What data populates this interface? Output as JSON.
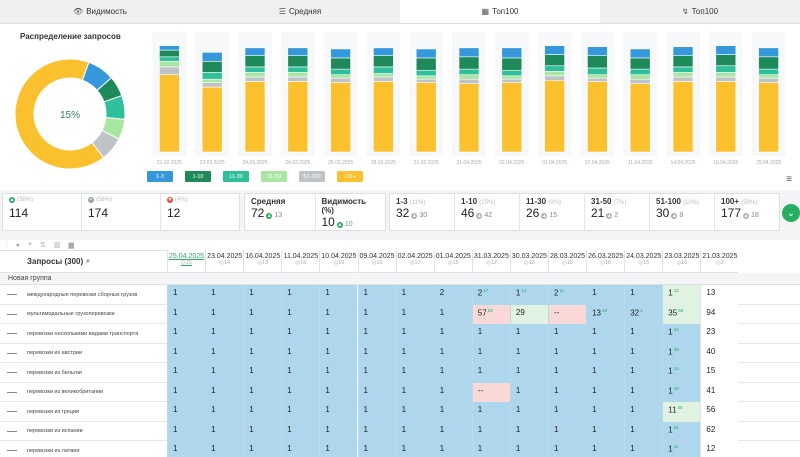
{
  "tabs": [
    {
      "label": "Видимость",
      "icon": "eye-icon",
      "glyph": "👁"
    },
    {
      "label": "Средняя",
      "icon": "list-icon",
      "glyph": "☰"
    },
    {
      "label": "Топ100",
      "icon": "calendar-icon",
      "glyph": "▦"
    },
    {
      "label": "Топ100",
      "icon": "trend-icon",
      "glyph": "↯"
    }
  ],
  "distribution": {
    "title": "Распределение запросов",
    "center_label": "15%",
    "slices": [
      {
        "range": "1-3",
        "value": 8,
        "color": "#3498db"
      },
      {
        "range": "1-10",
        "value": 6,
        "color": "#1e8a5a"
      },
      {
        "range": "11-30",
        "value": 7,
        "color": "#2fbf9b"
      },
      {
        "range": "31-50",
        "value": 6,
        "color": "#a8e6a1"
      },
      {
        "range": "51-100",
        "value": 7,
        "color": "#bdc3c7"
      },
      {
        "range": "101+",
        "value": 66,
        "color": "#fbc02d"
      }
    ]
  },
  "chart_data": {
    "type": "bar",
    "stacked": true,
    "categories": [
      "21.02.2025",
      "",
      "",
      "",
      "",
      "",
      "",
      "",
      "",
      "",
      "",
      "",
      "",
      "",
      "",
      "",
      ""
    ],
    "tick_labels": [
      "21.02.2025",
      "",
      "23.02.2025",
      "",
      "28.03.2025",
      "",
      "28.03.2025",
      "",
      "31.03.2025",
      "",
      "31.03.2025",
      "",
      "31.04.2025",
      "",
      "03.04.2025",
      "",
      "15.04.2025"
    ],
    "categories_count": 15,
    "series": [
      {
        "name": "101+",
        "color": "#fbc02d",
        "values": [
          69,
          58,
          63,
          63,
          62,
          63,
          62,
          61,
          62,
          64,
          63,
          61,
          63,
          63,
          62
        ]
      },
      {
        "name": "51-100",
        "color": "#bdc3c7",
        "values": [
          7,
          4,
          4,
          4,
          4,
          4,
          3,
          4,
          3,
          4,
          3,
          4,
          4,
          4,
          4
        ]
      },
      {
        "name": "31-50",
        "color": "#a8e6a1",
        "values": [
          5,
          3,
          4,
          4,
          3,
          3,
          3,
          4,
          3,
          4,
          3,
          4,
          4,
          4,
          3
        ]
      },
      {
        "name": "11-30",
        "color": "#2fbf9b",
        "values": [
          4,
          6,
          5,
          5,
          5,
          6,
          5,
          5,
          5,
          5,
          6,
          5,
          5,
          6,
          5
        ]
      },
      {
        "name": "1-10",
        "color": "#1e8a5a",
        "values": [
          6,
          10,
          10,
          10,
          10,
          10,
          11,
          11,
          11,
          10,
          11,
          10,
          10,
          10,
          11
        ]
      },
      {
        "name": "1-3",
        "color": "#3498db",
        "values": [
          4,
          8,
          7,
          7,
          8,
          7,
          8,
          8,
          9,
          8,
          8,
          8,
          8,
          8,
          8
        ]
      }
    ],
    "x_labels": [
      "21.02.2025",
      "23.03.2025",
      "24.03.2025",
      "24.03.2025",
      "26.03.2025",
      "28.03.2025",
      "31.03.2025",
      "31.04.2025",
      "02.04.2025",
      "03.04.2025",
      "07.04.2025",
      "11.04.2025",
      "14.04.2025",
      "16.04.2025",
      "25.04.2025"
    ],
    "ylim": [
      0,
      100
    ]
  },
  "legend": [
    {
      "label": "1-3",
      "color": "#3498db"
    },
    {
      "label": "1-10",
      "color": "#1e8a5a"
    },
    {
      "label": "11-30",
      "color": "#2fbf9b"
    },
    {
      "label": "31-50",
      "color": "#a8e6a1"
    },
    {
      "label": "51-100",
      "color": "#bdc3c7"
    },
    {
      "label": "101+",
      "color": "#fbc02d"
    }
  ],
  "stats_a": [
    {
      "top": "(38%)",
      "icon": "up",
      "value": "114"
    },
    {
      "top": "(58%)",
      "icon": "same",
      "value": "174"
    },
    {
      "top": "(4%)",
      "icon": "down",
      "value": "12"
    }
  ],
  "stats_b": [
    {
      "label": "Средняя",
      "value": "72",
      "change": "13"
    },
    {
      "label": "Видимость (%)",
      "value": "10",
      "change": "10"
    }
  ],
  "stats_c": [
    {
      "label": "1-3",
      "pct": "(11%)",
      "value": "32",
      "change": "30"
    },
    {
      "label": "1-10",
      "pct": "(15%)",
      "value": "46",
      "change": "42"
    },
    {
      "label": "11-30",
      "pct": "(9%)",
      "value": "26",
      "change": "15"
    },
    {
      "label": "31-50",
      "pct": "(7%)",
      "value": "21",
      "change": "2"
    },
    {
      "label": "51-100",
      "pct": "(10%)",
      "value": "30",
      "change": "8"
    },
    {
      "label": "100+",
      "pct": "(59%)",
      "value": "177",
      "change": "18"
    }
  ],
  "table": {
    "query_header": "Запросы (300)",
    "group": "Новая группа",
    "dates": [
      {
        "date": "25.04.2025",
        "sub": "15"
      },
      {
        "date": "23.04.2025",
        "sub": "14"
      },
      {
        "date": "16.04.2025",
        "sub": "13"
      },
      {
        "date": "11.04.2025",
        "sub": "16"
      },
      {
        "date": "10.04.2025",
        "sub": "16"
      },
      {
        "date": "09.04.2025",
        "sub": "16"
      },
      {
        "date": "02.04.2025",
        "sub": "17"
      },
      {
        "date": "01.04.2025",
        "sub": "15"
      },
      {
        "date": "31.03.2025",
        "sub": "12"
      },
      {
        "date": "30.03.2025",
        "sub": "13"
      },
      {
        "date": "28.03.2025",
        "sub": "15"
      },
      {
        "date": "26.03.2025",
        "sub": "16"
      },
      {
        "date": "24.03.2025",
        "sub": "15"
      },
      {
        "date": "23.03.2025",
        "sub": "16"
      },
      {
        "date": "21.03.2025",
        "sub": "2"
      }
    ],
    "rows": [
      {
        "name": "международные перевозки сборных грузов",
        "cells": [
          "1",
          "1",
          "1",
          "1",
          "1",
          "1",
          "1",
          "2",
          "2",
          "1",
          "2",
          "1",
          "1",
          "1",
          "13"
        ],
        "sups": [
          "",
          "",
          "",
          "",
          "",
          "",
          "",
          "",
          "17",
          "12",
          "11",
          "",
          "",
          "12",
          ""
        ],
        "colors": [
          "b",
          "b",
          "b",
          "b",
          "b",
          "b",
          "b",
          "b",
          "b",
          "b",
          "b",
          "b",
          "b",
          "g",
          "w"
        ]
      },
      {
        "name": "мультимодальные грузоперевозки",
        "cells": [
          "1",
          "1",
          "1",
          "1",
          "1",
          "1",
          "1",
          "1",
          "57",
          "29",
          "--",
          "13",
          "32",
          "35",
          "94"
        ],
        "sups": [
          "",
          "",
          "",
          "",
          "",
          "",
          "",
          "",
          "28",
          "",
          "",
          "19",
          "1",
          "59",
          ""
        ],
        "colors": [
          "b",
          "b",
          "b",
          "b",
          "b",
          "b",
          "b",
          "b",
          "p",
          "g",
          "p",
          "b",
          "b",
          "g",
          "w"
        ]
      },
      {
        "name": "перевозки несколькими видами транспорта",
        "cells": [
          "1",
          "1",
          "1",
          "1",
          "1",
          "1",
          "1",
          "1",
          "1",
          "1",
          "1",
          "1",
          "1",
          "1",
          "23"
        ],
        "sups": [
          "",
          "",
          "",
          "",
          "",
          "",
          "",
          "",
          "",
          "",
          "",
          "",
          "",
          "22",
          ""
        ],
        "colors": [
          "b",
          "b",
          "b",
          "b",
          "b",
          "b",
          "b",
          "b",
          "b",
          "b",
          "b",
          "b",
          "b",
          "b",
          "w"
        ]
      },
      {
        "name": "перевозки из австрии",
        "cells": [
          "1",
          "1",
          "1",
          "1",
          "1",
          "1",
          "1",
          "1",
          "1",
          "1",
          "1",
          "1",
          "1",
          "1",
          "40"
        ],
        "sups": [
          "",
          "",
          "",
          "",
          "",
          "",
          "",
          "",
          "",
          "",
          "",
          "",
          "",
          "39",
          ""
        ],
        "colors": [
          "b",
          "b",
          "b",
          "b",
          "b",
          "b",
          "b",
          "b",
          "b",
          "b",
          "b",
          "b",
          "b",
          "b",
          "w"
        ]
      },
      {
        "name": "перевозки из бельгии",
        "cells": [
          "1",
          "1",
          "1",
          "1",
          "1",
          "1",
          "1",
          "1",
          "1",
          "1",
          "1",
          "1",
          "1",
          "1",
          "15"
        ],
        "sups": [
          "",
          "",
          "",
          "",
          "",
          "",
          "",
          "",
          "",
          "",
          "",
          "",
          "",
          "14",
          ""
        ],
        "colors": [
          "b",
          "b",
          "b",
          "b",
          "b",
          "b",
          "b",
          "b",
          "b",
          "b",
          "b",
          "b",
          "b",
          "b",
          "w"
        ]
      },
      {
        "name": "перевозки из великобритании",
        "cells": [
          "1",
          "1",
          "1",
          "1",
          "1",
          "1",
          "1",
          "1",
          "--",
          "1",
          "1",
          "1",
          "1",
          "1",
          "41"
        ],
        "sups": [
          "",
          "",
          "",
          "",
          "",
          "",
          "",
          "",
          "",
          "",
          "",
          "",
          "",
          "40",
          ""
        ],
        "colors": [
          "b",
          "b",
          "b",
          "b",
          "b",
          "b",
          "b",
          "b",
          "p",
          "b",
          "b",
          "b",
          "b",
          "b",
          "w"
        ]
      },
      {
        "name": "перевозки из греции",
        "cells": [
          "1",
          "1",
          "1",
          "1",
          "1",
          "1",
          "1",
          "1",
          "1",
          "1",
          "1",
          "1",
          "1",
          "11",
          "56"
        ],
        "sups": [
          "",
          "",
          "",
          "",
          "",
          "",
          "",
          "",
          "",
          "",
          "",
          "",
          "",
          "45",
          ""
        ],
        "colors": [
          "b",
          "b",
          "b",
          "b",
          "b",
          "b",
          "b",
          "b",
          "b",
          "b",
          "b",
          "b",
          "b",
          "g",
          "w"
        ]
      },
      {
        "name": "перевозки из испании",
        "cells": [
          "1",
          "1",
          "1",
          "1",
          "1",
          "1",
          "1",
          "1",
          "1",
          "1",
          "1",
          "1",
          "1",
          "1",
          "62"
        ],
        "sups": [
          "",
          "",
          "",
          "",
          "",
          "",
          "",
          "",
          "",
          "",
          "",
          "",
          "",
          "61",
          ""
        ],
        "colors": [
          "b",
          "b",
          "b",
          "b",
          "b",
          "b",
          "b",
          "b",
          "b",
          "b",
          "b",
          "b",
          "b",
          "b",
          "w"
        ]
      },
      {
        "name": "перевозки из латвии",
        "cells": [
          "1",
          "1",
          "1",
          "1",
          "1",
          "1",
          "1",
          "1",
          "1",
          "1",
          "1",
          "1",
          "1",
          "1",
          "12"
        ],
        "sups": [
          "",
          "",
          "",
          "",
          "",
          "",
          "",
          "",
          "",
          "",
          "",
          "",
          "",
          "11",
          ""
        ],
        "colors": [
          "b",
          "b",
          "b",
          "b",
          "b",
          "b",
          "b",
          "b",
          "b",
          "b",
          "b",
          "b",
          "b",
          "b",
          "w"
        ]
      }
    ]
  }
}
